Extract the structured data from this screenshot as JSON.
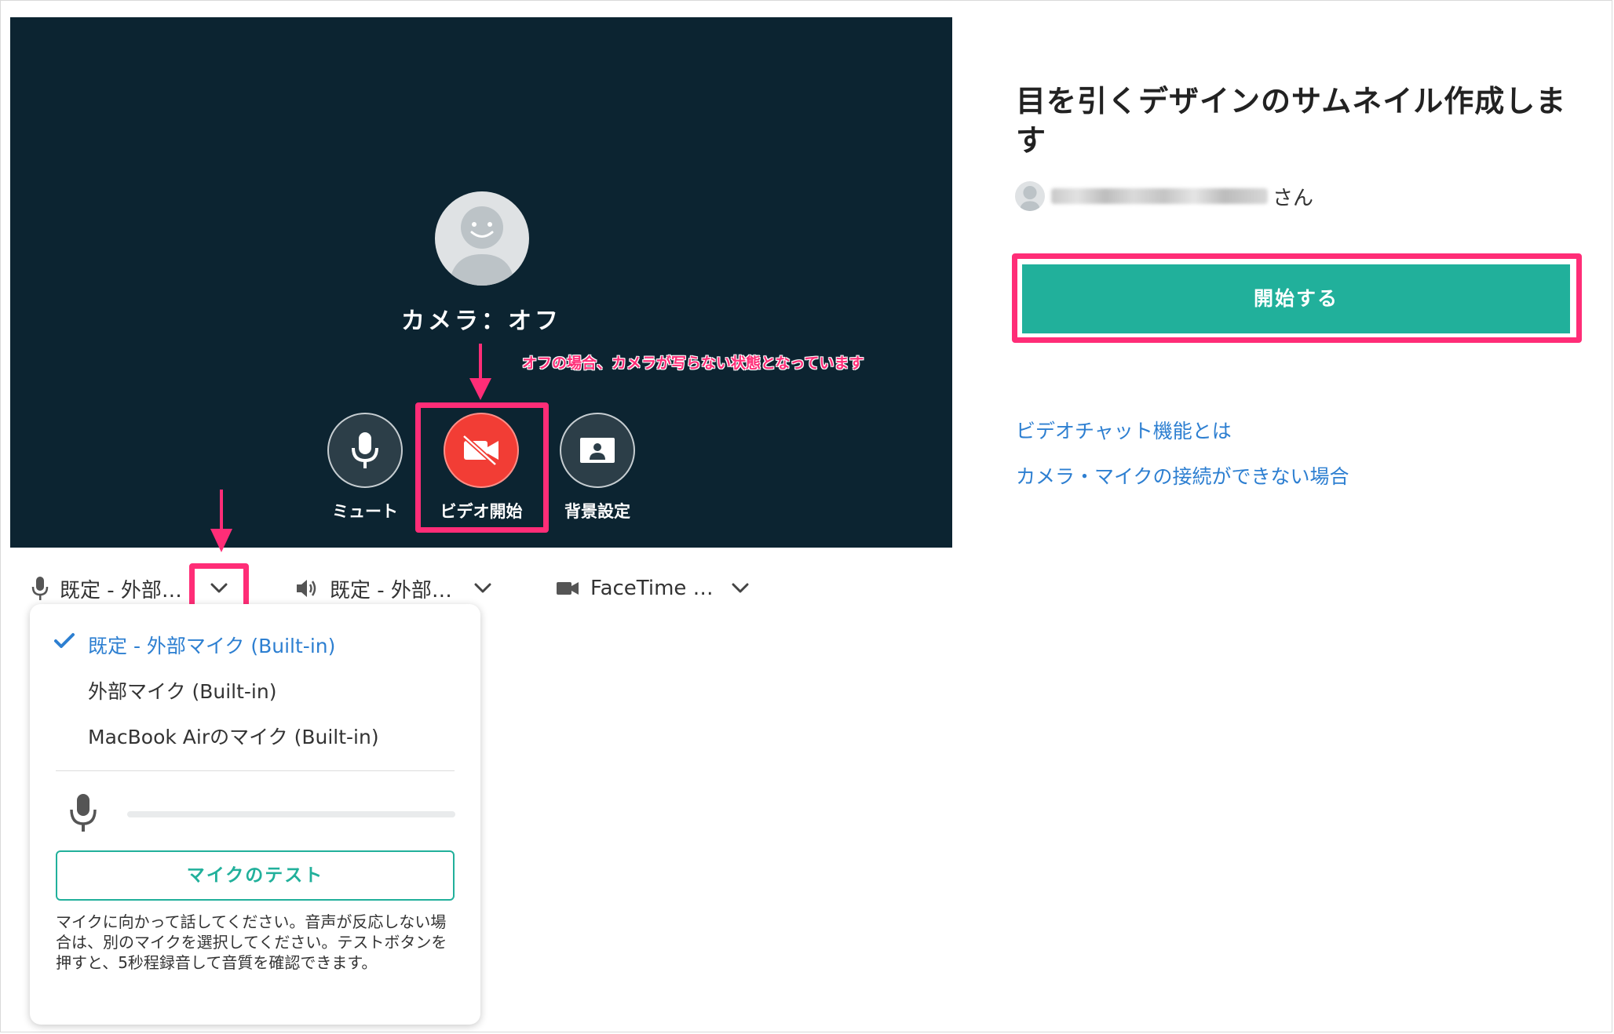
{
  "preview": {
    "camera_status": "カメラ：オフ",
    "controls": {
      "mute_label": "ミュート",
      "video_label": "ビデオ開始",
      "background_label": "背景設定"
    },
    "annotation": "オフの場合、カメラが写らない状態となっています"
  },
  "devices": {
    "mic": "既定 - 外部…",
    "speaker": "既定 - 外部…",
    "camera": "FaceTime …"
  },
  "mic_dropdown": {
    "options": [
      {
        "label": "既定 - 外部マイク (Built-in)",
        "selected": true
      },
      {
        "label": "外部マイク (Built-in)",
        "selected": false
      },
      {
        "label": "MacBook Airのマイク (Built-in)",
        "selected": false
      }
    ],
    "input_level": 0,
    "test_button": "マイクのテスト",
    "help_text": "マイクに向かって話してください。音声が反応しない場合は、別のマイクを選択してください。テストボタンを押すと、5秒程録音して音質を確認できます。"
  },
  "session": {
    "title": "目を引くデザインのサムネイル作成します",
    "user_suffix": "さん",
    "start_button": "開始する",
    "links": [
      "ビデオチャット機能とは",
      "カメラ・マイクの接続ができない場合"
    ]
  },
  "colors": {
    "video_bg": "#0c2431",
    "accent_green": "#21b09b",
    "link_blue": "#2d7fd1",
    "highlight_pink": "#ff2d77",
    "video_off_red": "#f23d35"
  },
  "icons": [
    "microphone-icon",
    "video-off-icon",
    "background-portrait-icon",
    "speaker-icon",
    "camera-icon",
    "chevron-down-icon",
    "checkmark-icon",
    "avatar-icon"
  ]
}
